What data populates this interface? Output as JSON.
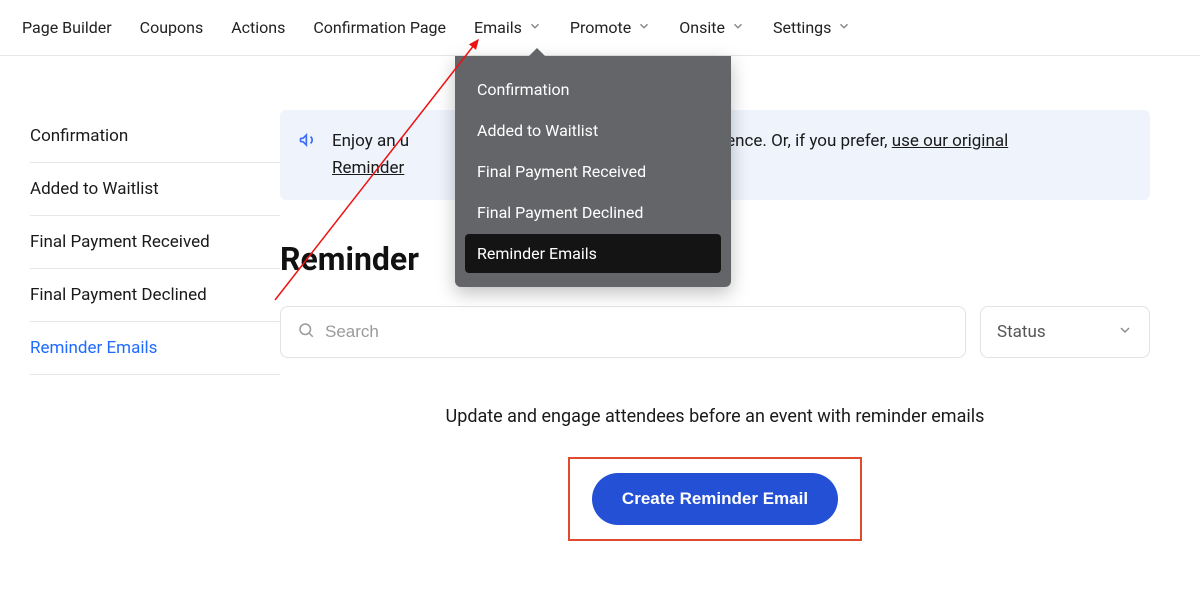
{
  "topnav": {
    "items": [
      {
        "label": "Page Builder",
        "has_chevron": false
      },
      {
        "label": "Coupons",
        "has_chevron": false
      },
      {
        "label": "Actions",
        "has_chevron": false
      },
      {
        "label": "Confirmation Page",
        "has_chevron": false
      },
      {
        "label": "Emails",
        "has_chevron": true
      },
      {
        "label": "Promote",
        "has_chevron": true
      },
      {
        "label": "Onsite",
        "has_chevron": true
      },
      {
        "label": "Settings",
        "has_chevron": true
      }
    ]
  },
  "dropdown": {
    "items": [
      {
        "label": "Confirmation",
        "active": false
      },
      {
        "label": "Added to Waitlist",
        "active": false
      },
      {
        "label": "Final Payment Received",
        "active": false
      },
      {
        "label": "Final Payment Declined",
        "active": false
      },
      {
        "label": "Reminder Emails",
        "active": true
      }
    ]
  },
  "sidebar": {
    "items": [
      {
        "label": "Confirmation",
        "active": false
      },
      {
        "label": "Added to Waitlist",
        "active": false
      },
      {
        "label": "Final Payment Received",
        "active": false
      },
      {
        "label": "Final Payment Declined",
        "active": false
      },
      {
        "label": "Reminder Emails",
        "active": true
      }
    ]
  },
  "banner": {
    "prefix": "Enjoy an u",
    "mid": "xperience. Or, if you prefer, ",
    "link": "use our original",
    "second_line_prefix": "Reminder"
  },
  "page_title": "Reminder",
  "search": {
    "placeholder": "Search"
  },
  "status_select": {
    "label": "Status"
  },
  "empty_state": {
    "message": "Update and engage attendees before an event with reminder emails",
    "cta_label": "Create Reminder Email"
  }
}
